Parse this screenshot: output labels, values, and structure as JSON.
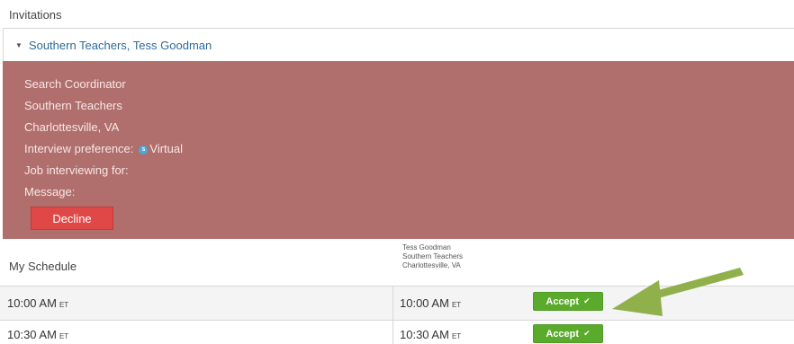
{
  "invitations": {
    "title": "Invitations",
    "item": {
      "header": "Southern Teachers, Tess Goodman",
      "role": "Search Coordinator",
      "organization": "Southern Teachers",
      "location": "Charlottesville, VA",
      "interview_preference_label": "Interview preference:",
      "skype_icon_letter": "s",
      "interview_preference_value": "Virtual",
      "job_label": "Job interviewing for:",
      "message_label": "Message:",
      "decline_label": "Decline"
    },
    "panel_color": "#b06f6d"
  },
  "schedule": {
    "title": "My Schedule",
    "contact": {
      "name": "Tess Goodman",
      "organization": "Southern Teachers",
      "location": "Charlottesville, VA"
    },
    "slots": [
      {
        "my_time": "10:00 AM",
        "my_tz": "ET",
        "their_time": "10:00 AM",
        "their_tz": "ET",
        "action": "Accept"
      },
      {
        "my_time": "10:30 AM",
        "my_tz": "ET",
        "their_time": "10:30 AM",
        "their_tz": "ET",
        "action": "Accept"
      }
    ],
    "accept_color": "#5aab2b"
  },
  "annotation": {
    "arrow_color": "#8fb04a",
    "arrow_icon": "pointer-arrow"
  }
}
